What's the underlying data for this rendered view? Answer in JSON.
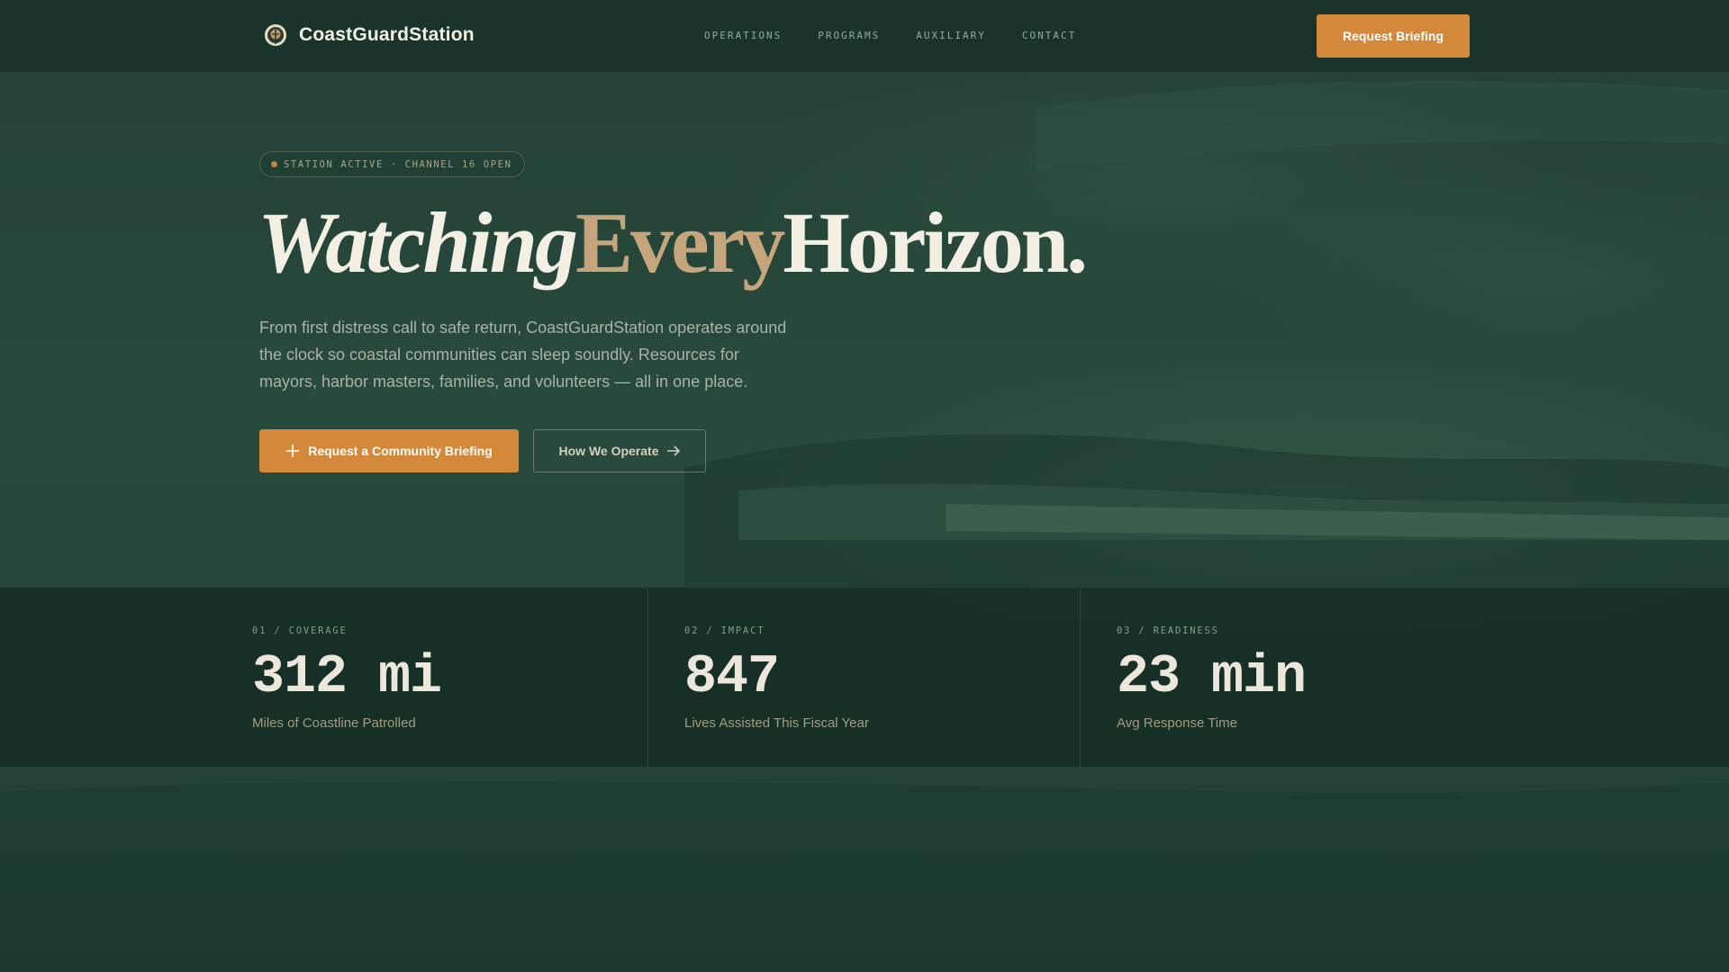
{
  "brand": {
    "name": "CoastGuardStation",
    "logo_icon": "lifebuoy-shield-icon"
  },
  "nav": {
    "items": [
      {
        "label": "OPERATIONS"
      },
      {
        "label": "PROGRAMS"
      },
      {
        "label": "AUXILIARY"
      },
      {
        "label": "CONTACT"
      }
    ],
    "cta_label": "Request Briefing"
  },
  "hero": {
    "status": "STATION ACTIVE · CHANNEL 16 OPEN",
    "headline": {
      "word1": "Watching",
      "word2": "Every",
      "word3": "Horizon."
    },
    "lede": "From first distress call to safe return, CoastGuardStation operates around the clock so coastal communities can sleep soundly. Resources for mayors, harbor masters, families, and volunteers — all in one place.",
    "primary_cta": {
      "label": "Request a Community Briefing",
      "icon": "plus-icon"
    },
    "secondary_cta": {
      "label": "How We Operate",
      "icon": "arrow-right-icon"
    }
  },
  "stats": [
    {
      "label": "01 / COVERAGE",
      "value": "312 mi",
      "caption": "Miles of Coastline Patrolled"
    },
    {
      "label": "02 / IMPACT",
      "value": "847",
      "caption": "Lives Assisted This Fiscal Year"
    },
    {
      "label": "03 / READINESS",
      "value": "23 min",
      "caption": "Avg Response Time"
    }
  ],
  "colors": {
    "accent": "#d4893a",
    "headline_highlight": "#c4a57c",
    "background": "#1e3a30"
  }
}
